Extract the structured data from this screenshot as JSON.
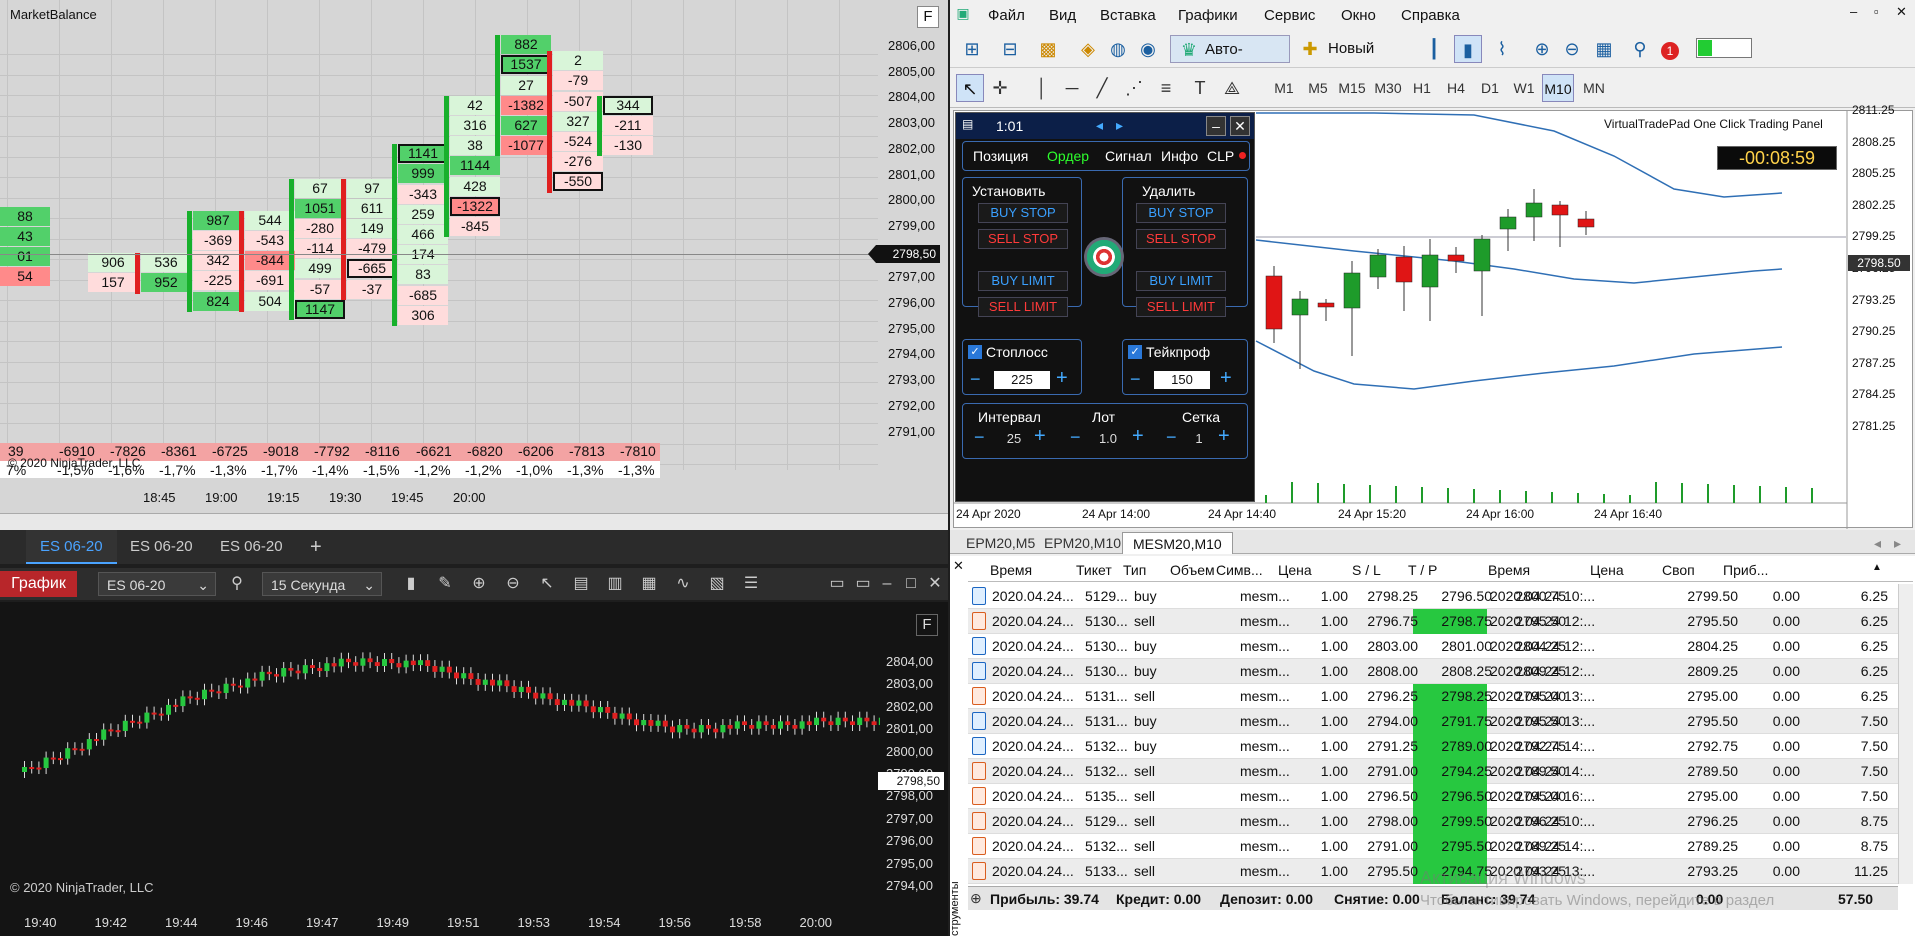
{
  "market_balance": {
    "title": "MarketBalance",
    "f_label": "F",
    "price_labels": [
      "2806,00",
      "2805,00",
      "2804,00",
      "2803,00",
      "2802,00",
      "2801,00",
      "2800,00",
      "2799,00",
      "2798,00",
      "2797,00",
      "2796,00",
      "2795,00",
      "2794,00",
      "2793,00",
      "2792,00",
      "2791,00"
    ],
    "current_price": "2798,50",
    "time_labels": [
      "18:45",
      "19:00",
      "19:15",
      "19:30",
      "19:45",
      "20:00"
    ],
    "copyright": "© 2020 NinjaTrader, LLC",
    "delta_row": [
      "39",
      "-6910",
      "-7826",
      "-8361",
      "-6725",
      "-9018",
      "-7792",
      "-8116",
      "-6621",
      "-6820",
      "-6206",
      "-7813",
      "-7810"
    ],
    "pct_row": [
      "7%",
      "-1,5%",
      "-1,6%",
      "-1,7%",
      "-1,3%",
      "-1,7%",
      "-1,4%",
      "-1,5%",
      "-1,2%",
      "-1,2%",
      "-1,0%",
      "-1,3%",
      "-1,3%"
    ],
    "columns": [
      {
        "cells": [
          [
            "88",
            "g"
          ],
          [
            "43",
            "g"
          ],
          [
            "01",
            "g"
          ],
          [
            "54",
            "r"
          ]
        ]
      },
      {
        "cells": []
      },
      {
        "cells": [
          [
            "906",
            "lg"
          ],
          [
            "157",
            "lr"
          ]
        ]
      },
      {
        "cells": [
          [
            "536",
            "lg"
          ],
          [
            "952",
            "g"
          ]
        ]
      },
      {
        "cells": [
          [
            "987",
            "g"
          ],
          [
            "-369",
            "lr"
          ],
          [
            "342",
            "lr"
          ],
          [
            "-225",
            "lr"
          ],
          [
            "824",
            "g"
          ]
        ]
      },
      {
        "cells": [
          [
            "544",
            "lg"
          ],
          [
            "-543",
            "lr"
          ],
          [
            "-844",
            "r"
          ],
          [
            "-691",
            "lr"
          ],
          [
            "504",
            "lg"
          ]
        ]
      },
      {
        "cells": [
          [
            "67",
            "lg"
          ],
          [
            "1051",
            "g"
          ],
          [
            "-280",
            "lr"
          ],
          [
            "-114",
            "lr"
          ],
          [
            "499",
            "lg"
          ],
          [
            "-57",
            "lr"
          ],
          [
            "1147",
            "gb"
          ]
        ]
      },
      {
        "cells": [
          [
            "97",
            "lg"
          ],
          [
            "611",
            "lg"
          ],
          [
            "149",
            "lg"
          ],
          [
            "-479",
            "lr"
          ],
          [
            "-665",
            "lrb"
          ],
          [
            "-37",
            "lr"
          ]
        ]
      },
      {
        "cells": [
          [
            "1141",
            "gb"
          ],
          [
            "999",
            "g"
          ],
          [
            "-343",
            "lr"
          ],
          [
            "259",
            "lg"
          ],
          [
            "466",
            "lg"
          ],
          [
            "174",
            "lg"
          ],
          [
            "83",
            "lg"
          ],
          [
            "-685",
            "lr"
          ],
          [
            "306",
            "lr"
          ]
        ]
      },
      {
        "cells": [
          [
            "42",
            "lg"
          ],
          [
            "316",
            "lg"
          ],
          [
            "38",
            "lg"
          ],
          [
            "1144",
            "g"
          ],
          [
            "428",
            "lg"
          ],
          [
            "-1322",
            "rb"
          ],
          [
            "-845",
            "lr"
          ]
        ]
      },
      {
        "cells": [
          [
            "882",
            "g"
          ],
          [
            "1537",
            "gb"
          ],
          [
            "27",
            "lg"
          ],
          [
            "-1382",
            "r"
          ],
          [
            "627",
            "g"
          ],
          [
            "-1077",
            "r"
          ]
        ]
      },
      {
        "cells": [
          [
            "2",
            "lg"
          ],
          [
            "-79",
            "lr"
          ],
          [
            "-507",
            "lr"
          ],
          [
            "327",
            "lg"
          ],
          [
            "-524",
            "lr"
          ],
          [
            "-276",
            "lr"
          ],
          [
            "-550",
            "lrb"
          ]
        ]
      },
      {
        "cells": [
          [
            "344",
            "lgb"
          ],
          [
            "-211",
            "lr"
          ],
          [
            "-130",
            "lr"
          ]
        ]
      }
    ]
  },
  "workspace_tabs": [
    "ES 06-20",
    "ES 06-20",
    "ES 06-20",
    "+"
  ],
  "nt_chart": {
    "label": "График",
    "instrument": "ES 06-20",
    "interval": "15 Секунда",
    "f_label": "F",
    "price_labels": [
      "2804,00",
      "2803,00",
      "2802,00",
      "2801,00",
      "2800,00",
      "2799,00",
      "2798,00",
      "2797,00",
      "2796,00",
      "2795,00",
      "2794,00"
    ],
    "current_price": "2798,50",
    "time_labels": [
      "19:40",
      "19:42",
      "19:44",
      "19:46",
      "19:47",
      "19:49",
      "19:51",
      "19:53",
      "19:54",
      "19:56",
      "19:58",
      "20:00"
    ],
    "copyright": "© 2020 NinjaTrader, LLC"
  },
  "mt5": {
    "menu": [
      "Файл",
      "Вид",
      "Вставка",
      "Графики",
      "Сервис",
      "Окно",
      "Справка"
    ],
    "auto_trading": "Авто-торговля",
    "new_order": "Новый ордер",
    "notification_count": "1",
    "timeframes": [
      "M1",
      "M5",
      "M15",
      "M30",
      "H1",
      "H4",
      "D1",
      "W1",
      "M10",
      "MN"
    ],
    "active_timeframe": "M10",
    "panel_title": "VirtualTradePad One Click Trading Panel",
    "timer": "-00:08:59",
    "price_labels": [
      "2811.25",
      "2808.25",
      "2805.25",
      "2802.25",
      "2799.25",
      "2796.25",
      "2793.25",
      "2790.25",
      "2787.25",
      "2784.25",
      "2781.25"
    ],
    "current_price": "2798.50",
    "time_labels": [
      "24 Apr 2020",
      "24 Apr 14:00",
      "24 Apr 14:40",
      "24 Apr 15:20",
      "24 Apr 16:00",
      "24 Apr 16:40"
    ],
    "vtp": {
      "clock": "1:01",
      "tabs": [
        "Позиция",
        "Ордер",
        "Сигнал",
        "Инфо",
        "CLP"
      ],
      "set": "Установить",
      "remove": "Удалить",
      "buy_stop": "BUY STOP",
      "sell_stop": "SELL STOP",
      "buy_limit": "BUY LIMIT",
      "sell_limit": "SELL LIMIT",
      "stoploss": "Стоплосс",
      "takeprofit": "Тейкпроф",
      "sl_value": "225",
      "tp_value": "150",
      "interval_label": "Интервал",
      "lot_label": "Лот",
      "grid_label": "Сетка",
      "interval_value": "25",
      "lot_value": "1.0",
      "grid_value": "1"
    },
    "chart_tabs": [
      "EPM20,M5",
      "EPM20,M10",
      "MESM20,M10"
    ],
    "table": {
      "headers": [
        "Время",
        "Тикет",
        "Тип",
        "Объем",
        "Симв...",
        "Цена",
        "S / L",
        "T / P",
        "Время",
        "Цена",
        "Своп",
        "Приб..."
      ],
      "rows": [
        [
          "2020.04.24...",
          "5129...",
          "buy",
          "1.00",
          "mesm...",
          "2798.25",
          "2796.50",
          "2800.75",
          "2020.04.24 10:...",
          "2799.50",
          "0.00",
          "6.25"
        ],
        [
          "2020.04.24...",
          "5130...",
          "sell",
          "1.00",
          "mesm...",
          "2796.75",
          "2798.75",
          "2795.50",
          "2020.04.24 12:...",
          "2795.50",
          "0.00",
          "6.25"
        ],
        [
          "2020.04.24...",
          "5130...",
          "buy",
          "1.00",
          "mesm...",
          "2803.00",
          "2801.00",
          "2804.25",
          "2020.04.24 12:...",
          "2804.25",
          "0.00",
          "6.25"
        ],
        [
          "2020.04.24...",
          "5130...",
          "buy",
          "1.00",
          "mesm...",
          "2808.00",
          "2808.25",
          "2809.25",
          "2020.04.24 12:...",
          "2809.25",
          "0.00",
          "6.25"
        ],
        [
          "2020.04.24...",
          "5131...",
          "sell",
          "1.00",
          "mesm...",
          "2796.25",
          "2798.25",
          "2795.00",
          "2020.04.24 13:...",
          "2795.00",
          "0.00",
          "6.25"
        ],
        [
          "2020.04.24...",
          "5131...",
          "buy",
          "1.00",
          "mesm...",
          "2794.00",
          "2791.75",
          "2795.50",
          "2020.04.24 13:...",
          "2795.50",
          "0.00",
          "7.50"
        ],
        [
          "2020.04.24...",
          "5132...",
          "buy",
          "1.00",
          "mesm...",
          "2791.25",
          "2789.00",
          "2792.75",
          "2020.04.24 14:...",
          "2792.75",
          "0.00",
          "7.50"
        ],
        [
          "2020.04.24...",
          "5132...",
          "sell",
          "1.00",
          "mesm...",
          "2791.00",
          "2794.25",
          "2789.50",
          "2020.04.24 14:...",
          "2789.50",
          "0.00",
          "7.50"
        ],
        [
          "2020.04.24...",
          "5135...",
          "sell",
          "1.00",
          "mesm...",
          "2796.50",
          "2796.50",
          "2795.00",
          "2020.04.24 16:...",
          "2795.00",
          "0.00",
          "7.50"
        ],
        [
          "2020.04.24...",
          "5129...",
          "sell",
          "1.00",
          "mesm...",
          "2798.00",
          "2799.50",
          "2796.25",
          "2020.04.24 10:...",
          "2796.25",
          "0.00",
          "8.75"
        ],
        [
          "2020.04.24...",
          "5132...",
          "sell",
          "1.00",
          "mesm...",
          "2791.00",
          "2795.50",
          "2789.25",
          "2020.04.24 14:...",
          "2789.25",
          "0.00",
          "8.75"
        ],
        [
          "2020.04.24...",
          "5133...",
          "sell",
          "1.00",
          "mesm...",
          "2795.50",
          "2794.75",
          "2793.25",
          "2020.04.24 13:...",
          "2793.25",
          "0.00",
          "11.25"
        ]
      ],
      "footer": {
        "profit": "Прибыль: 39.74",
        "credit": "Кредит: 0.00",
        "deposit": "Депозит: 0.00",
        "withdraw": "Снятие: 0.00",
        "balance": "Баланс: 39.74",
        "swap_total": "0.00",
        "profit_total": "57.50"
      },
      "side_label": "струменты"
    },
    "watermark1": "Активация Windows",
    "watermark2": "Чтобы активировать Windows, перейдите в раздел"
  },
  "colors": {
    "green": "#27c840",
    "red": "#e02020",
    "ntbg": "#141414"
  }
}
